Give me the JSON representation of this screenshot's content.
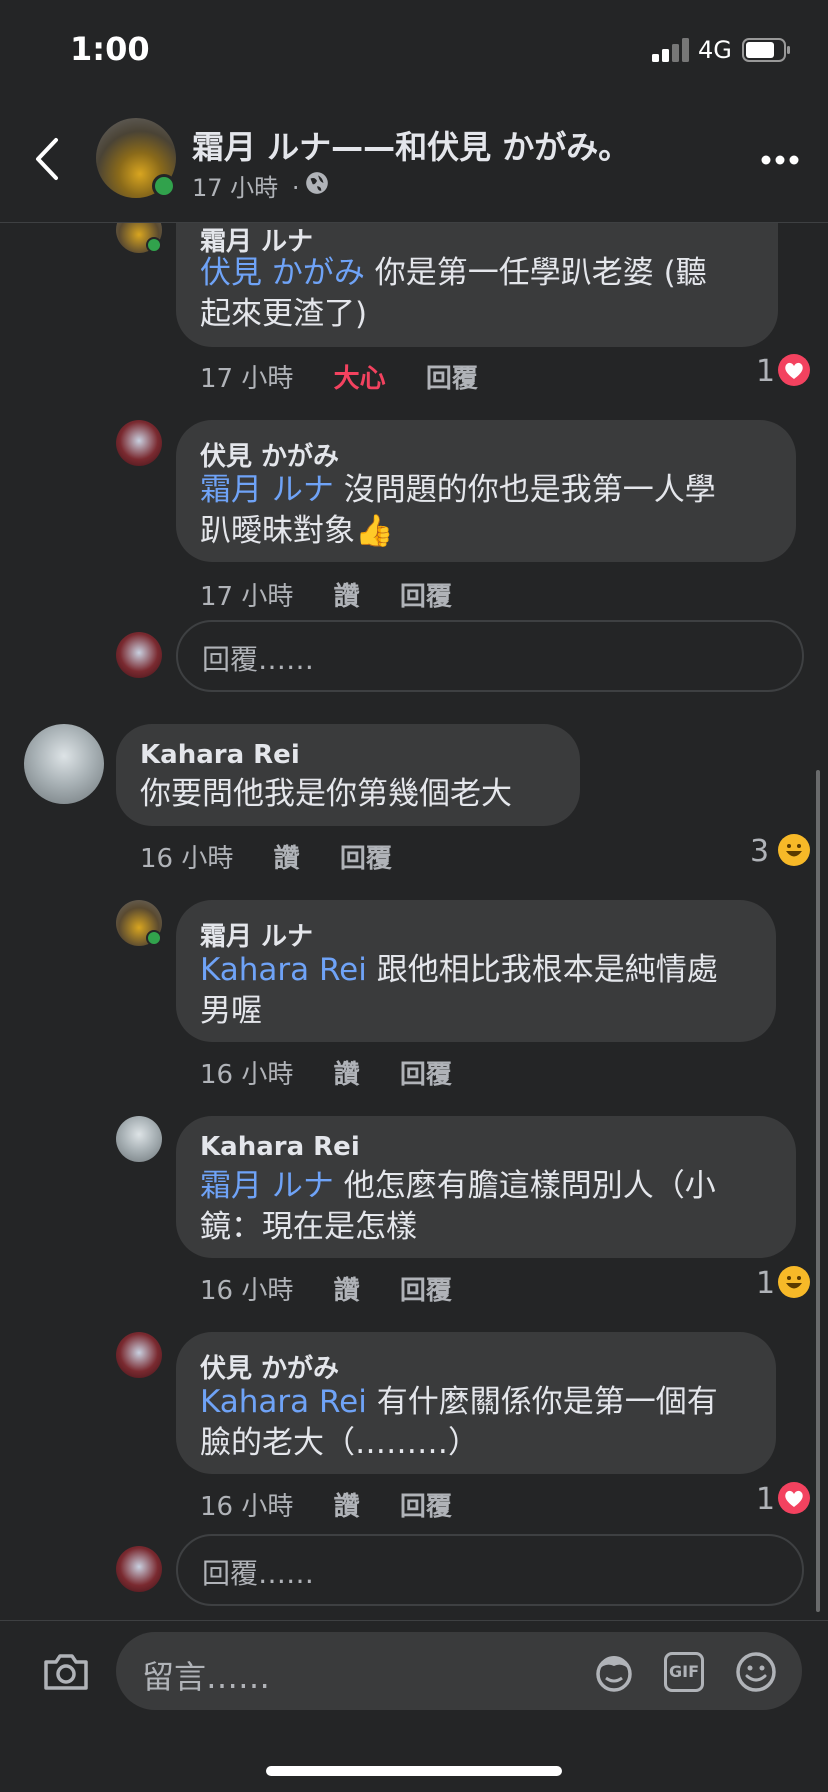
{
  "status_bar": {
    "time": "1:00",
    "network": "4G"
  },
  "post_header": {
    "title": "霜月 ルナ——和伏見 かがみ。",
    "time": "17 小時",
    "separator": "·"
  },
  "comments": {
    "c1": {
      "name": "霜月 ルナ",
      "mention": "伏見 かがみ",
      "text_line1": " 你是第一任學趴老婆 (聽",
      "text_line2": "起來更渣了)",
      "time": "17 小時",
      "action_react": "大心",
      "action_reply": "回覆",
      "reaction_count": "1",
      "reaction_icon": "heart-reaction"
    },
    "c2": {
      "name": "伏見 かがみ",
      "mention": "霜月 ルナ",
      "text_line1": " 沒問題的你也是我第一人學",
      "text_line2": "趴曖昧對象",
      "emoji": "👍",
      "time": "17 小時",
      "action_like": "讚",
      "action_reply": "回覆"
    },
    "reply_box_1": {
      "placeholder": "回覆……"
    },
    "c3": {
      "name": "Kahara Rei",
      "text": "你要問他我是你第幾個老大",
      "time": "16 小時",
      "action_like": "讚",
      "action_reply": "回覆",
      "reaction_count": "3",
      "reaction_icon": "haha-reaction"
    },
    "c4": {
      "name": "霜月 ルナ",
      "mention": "Kahara Rei",
      "text_line1": " 跟他相比我根本是純情處",
      "text_line2": "男喔",
      "time": "16 小時",
      "action_like": "讚",
      "action_reply": "回覆"
    },
    "c5": {
      "name": "Kahara Rei",
      "mention": "霜月 ルナ",
      "text_line1": " 他怎麼有膽這樣問別人（小",
      "text_line2": "鏡：現在是怎樣",
      "time": "16 小時",
      "action_like": "讚",
      "action_reply": "回覆",
      "reaction_count": "1",
      "reaction_icon": "haha-reaction"
    },
    "c6": {
      "name": "伏見 かがみ",
      "mention": "Kahara Rei",
      "text_line1": " 有什麼關係你是第一個有",
      "text_line2": "臉的老大（………）",
      "time": "16 小時",
      "action_like": "讚",
      "action_reply": "回覆",
      "reaction_count": "1",
      "reaction_icon": "heart-reaction"
    },
    "reply_box_2": {
      "placeholder": "回覆……"
    }
  },
  "bottom_bar": {
    "placeholder": "留言……",
    "gif_label": "GIF"
  },
  "colors": {
    "background": "#242526",
    "bubble": "#3a3b3c",
    "mention": "#6fa3f7",
    "love_text": "#f3425f",
    "online": "#31a24c"
  }
}
